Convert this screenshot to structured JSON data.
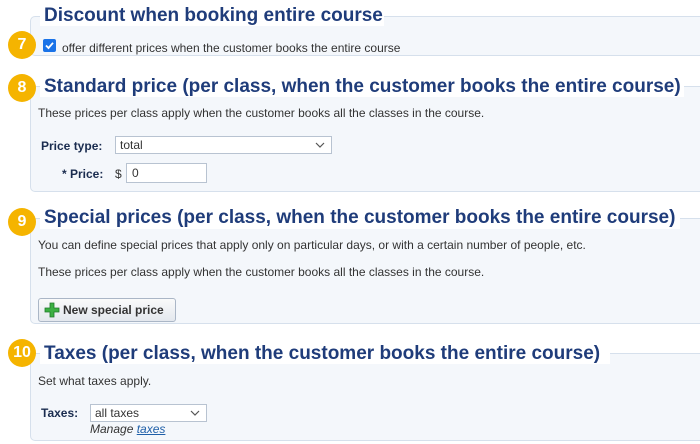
{
  "sections": {
    "discount": {
      "badge": "7",
      "title": "Discount when booking entire course",
      "checkbox_label": "offer different prices when the customer books the entire course",
      "checked": true
    },
    "standard": {
      "badge": "8",
      "title": "Standard price (per class, when the customer books the entire course)",
      "description": "These prices per class apply when the customer books all the classes in the course.",
      "price_type_label": "Price type:",
      "price_type_value": "total",
      "price_label": "* Price:",
      "currency": "$",
      "price_value": "0"
    },
    "special": {
      "badge": "9",
      "title": "Special prices (per class, when the customer books the entire course)",
      "description1": "You can define special prices that apply only on particular days, or with a certain number of people, etc.",
      "description2": "These prices per class apply when the customer books all the classes in the course.",
      "button_label": "New special price"
    },
    "taxes": {
      "badge": "10",
      "title": "Taxes (per class, when the customer books the entire course)",
      "description": "Set what taxes apply.",
      "taxes_label": "Taxes:",
      "taxes_value": "all taxes",
      "manage_prefix": "Manage",
      "manage_link": "taxes"
    }
  },
  "colors": {
    "heading": "#1f3c7a",
    "badge": "#f5b400",
    "section_bg": "#f4f7fb",
    "link": "#1f5fa8"
  }
}
